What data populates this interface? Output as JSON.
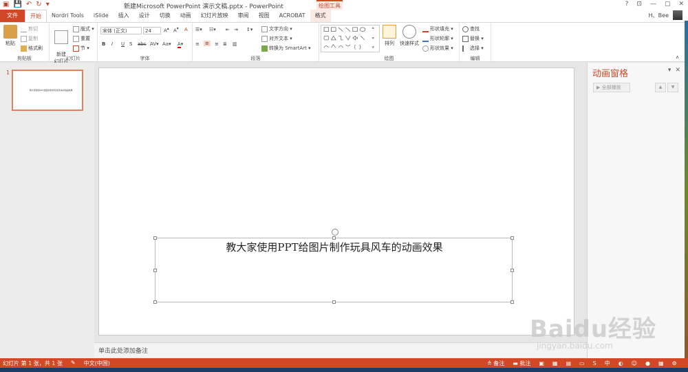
{
  "window": {
    "title": "新建Microsoft PowerPoint 演示文稿.pptx - PowerPoint",
    "contextual_header": "绘图工具",
    "controls": [
      "?",
      "⊡",
      "—",
      "▢",
      "✕"
    ]
  },
  "tabs": [
    "文件",
    "开始",
    "Nordri Tools",
    "iSlide",
    "插入",
    "设计",
    "切换",
    "动画",
    "幻灯片放映",
    "审阅",
    "视图",
    "ACROBAT",
    "格式"
  ],
  "user": {
    "name": "H、Bee"
  },
  "ribbon": {
    "clipboard": {
      "label": "剪贴板",
      "paste": "粘贴",
      "cut": "剪切",
      "copy": "复制",
      "format_painter": "格式刷"
    },
    "slides": {
      "label": "幻灯片",
      "new_slide": "新建\n幻灯片",
      "layout": "版式",
      "reset": "重置",
      "section": "节"
    },
    "font": {
      "label": "字体",
      "font_name": "宋体 (正文)",
      "font_size": "24"
    },
    "paragraph": {
      "label": "段落",
      "text_direction": "文字方向",
      "align_text": "对齐文本",
      "smartart": "转换为 SmartArt"
    },
    "drawing": {
      "label": "绘图",
      "arrange": "排列",
      "quick_styles": "快速样式",
      "shape_fill": "形状填充",
      "shape_outline": "形状轮廓",
      "shape_effects": "形状效果"
    },
    "editing": {
      "label": "编辑",
      "find": "查找",
      "replace": "替换",
      "select": "选择"
    }
  },
  "thumbnails": [
    {
      "number": "1",
      "text": "教大家使用PPT给图片制作玩具风车的动画效果"
    }
  ],
  "slide": {
    "title": "教大家使用PPT给图片制作玩具风车的动画效果"
  },
  "notes": {
    "placeholder": "单击此处添加备注"
  },
  "animation_pane": {
    "title": "动画窗格",
    "play_all": "全部播放"
  },
  "status": {
    "slide_info": "幻灯片 第 1 张，共 1 张",
    "language": "中文(中国)",
    "notes": "备注",
    "comments": "批注"
  },
  "watermark": {
    "main": "Baidu经验",
    "sub": "jingyan.baidu.com"
  },
  "colors": {
    "accent": "#d24726",
    "contextual_bg": "#fbe9e3"
  }
}
